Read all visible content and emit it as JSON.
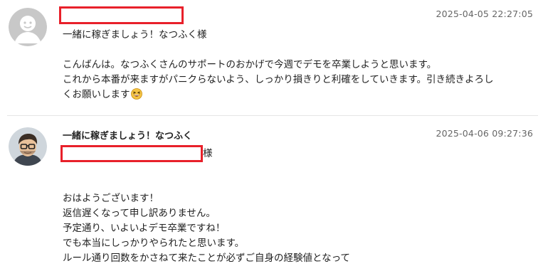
{
  "messages": [
    {
      "timestamp": "2025-04-05 22:27:05",
      "lines": [
        "一緒に稼ぎましょう！なつふく様",
        "",
        "こんばんは。なつふくさんのサポートのおかげで今週でデモを卒業しようと思います。",
        "これから本番が来ますがパニクらないよう、しっかり損きりと利確をしていきます。引き続きよろし",
        "くお願いします"
      ],
      "avatar_icon": "default-user-avatar-icon",
      "emoji_icon": "grinning-squinting-face-icon"
    },
    {
      "sender": "一緒に稼ぎましょう！なつふく",
      "timestamp": "2025-04-06 09:27:36",
      "recipient_suffix": "様",
      "lines": [
        "",
        "",
        "おはようございます！",
        "返信遅くなって申し訳ありません。",
        "予定通り、いよいよデモ卒業ですね！",
        "でも本当にしっかりやられたと思います。",
        "ルール通り回数をかさねて来たことが必ずご自身の経験値となって"
      ],
      "avatar_icon": "illustrated-man-with-glasses-avatar-icon"
    }
  ],
  "colors": {
    "redaction": "#e8202a",
    "timestamp": "#666666",
    "divider": "#e6e6e6"
  }
}
